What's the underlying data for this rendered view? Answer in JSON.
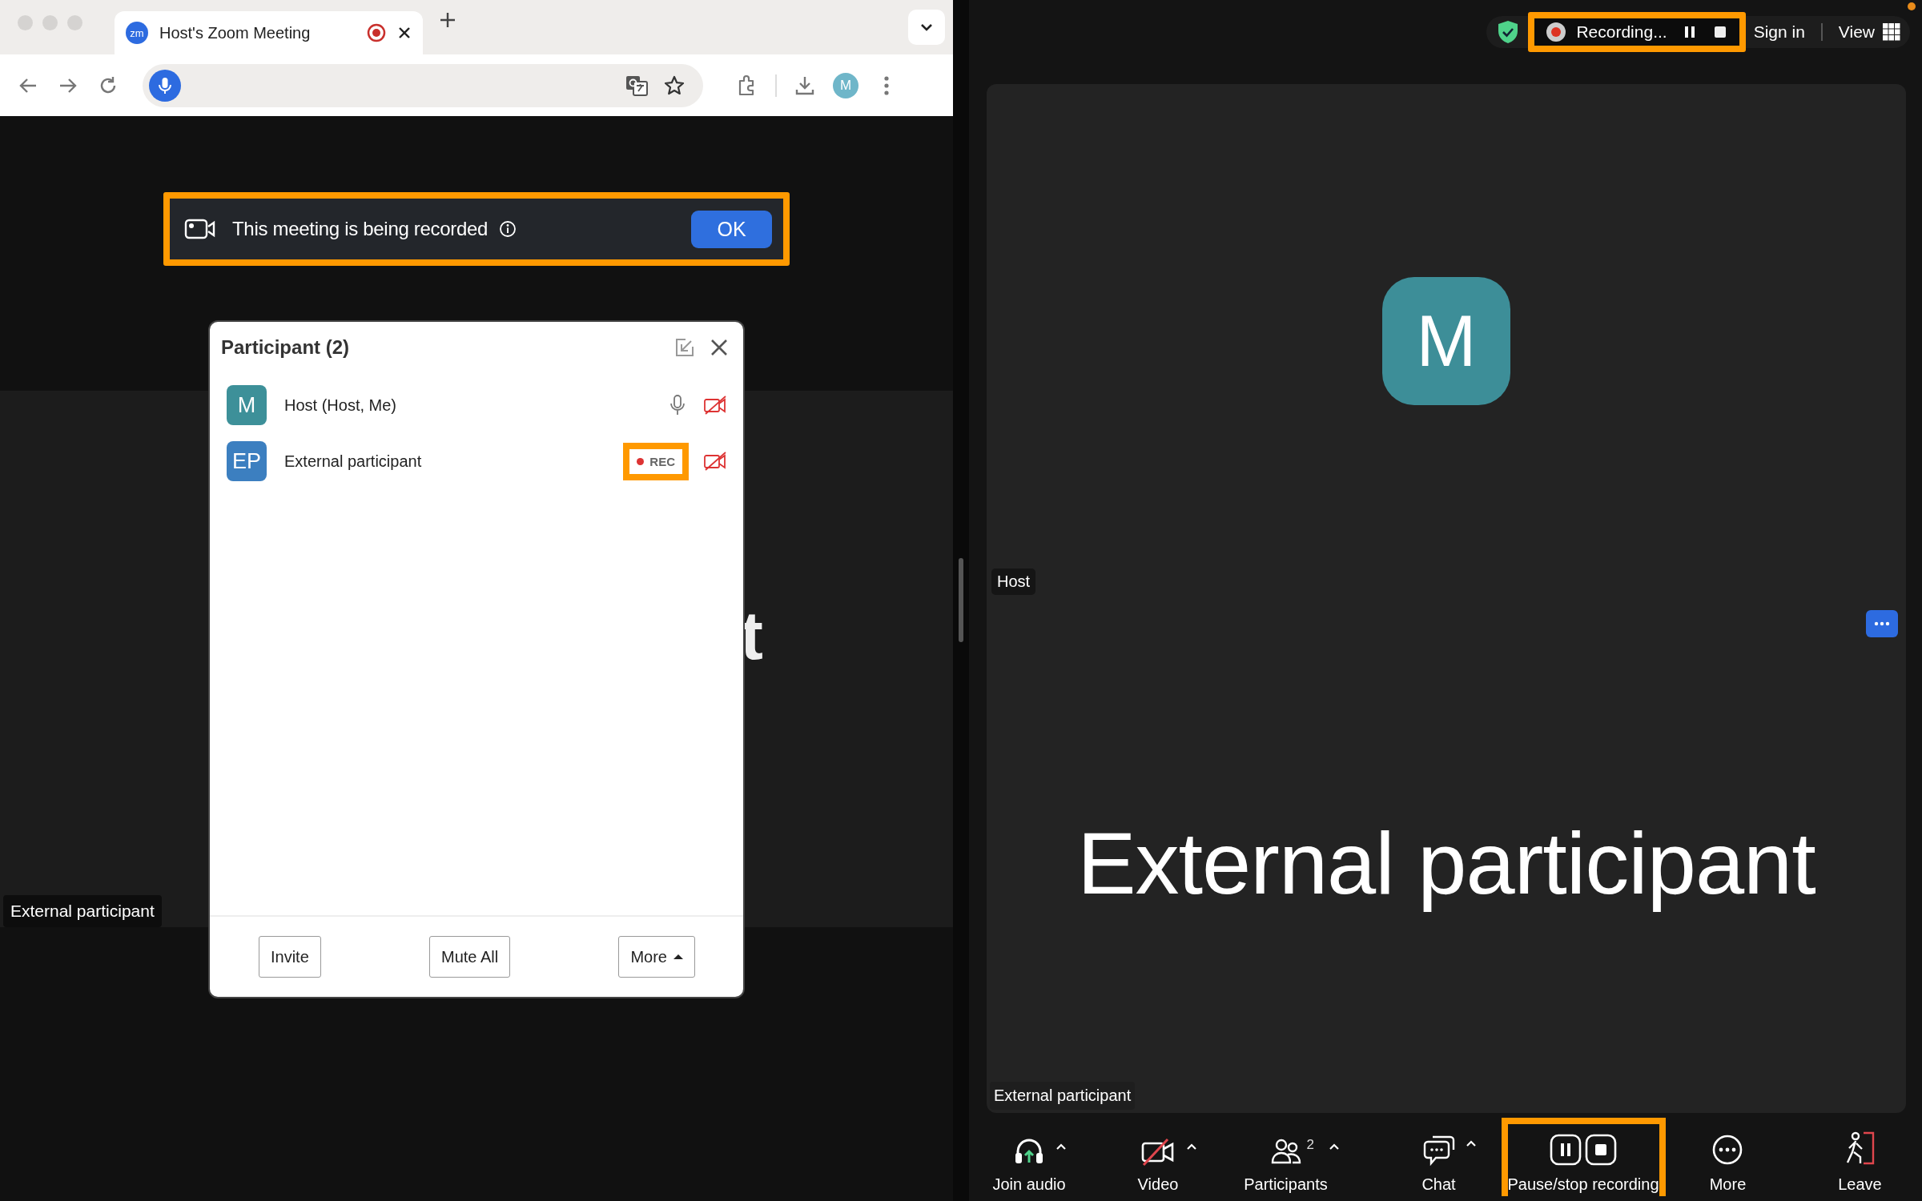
{
  "browser": {
    "tab": {
      "title": "Host's Zoom Meeting",
      "favicon": "zm",
      "recording": true
    },
    "profile_initial": "M"
  },
  "banner": {
    "text": "This meeting is being recorded",
    "button": "OK",
    "highlighted": true
  },
  "participants_panel": {
    "title": "Participant (2)",
    "participants": [
      {
        "initials": "M",
        "name": "Host (Host, Me)",
        "color": "#3d9099",
        "mic": true,
        "recording": false,
        "video_off": true
      },
      {
        "initials": "EP",
        "name": "External participant",
        "color": "#3c7fc0",
        "mic": false,
        "recording": true,
        "rec_label": "REC",
        "video_off": true
      }
    ],
    "buttons": [
      "Invite",
      "Mute All",
      "More"
    ]
  },
  "left_tile": {
    "name_fragments": [
      "t"
    ],
    "label": "External participant"
  },
  "zoom_top": {
    "recording": {
      "text": "Recording...",
      "highlighted": true
    },
    "sign_in": "Sign in",
    "view": "View"
  },
  "host_tile": {
    "initial": "M",
    "label": "Host"
  },
  "speaker": {
    "name": "External participant",
    "label": "External participant"
  },
  "toolbar": [
    {
      "kind": "audio",
      "label": "Join audio",
      "caret": true
    },
    {
      "kind": "video",
      "label": "Video",
      "caret": true,
      "off": true
    },
    {
      "kind": "participants",
      "label": "Participants",
      "count": "2",
      "caret": true
    },
    {
      "kind": "chat",
      "label": "Chat",
      "caret": true
    },
    {
      "kind": "record",
      "label": "Pause/stop recording",
      "highlighted": true
    },
    {
      "kind": "more",
      "label": "More"
    },
    {
      "kind": "leave",
      "label": "Leave"
    }
  ]
}
